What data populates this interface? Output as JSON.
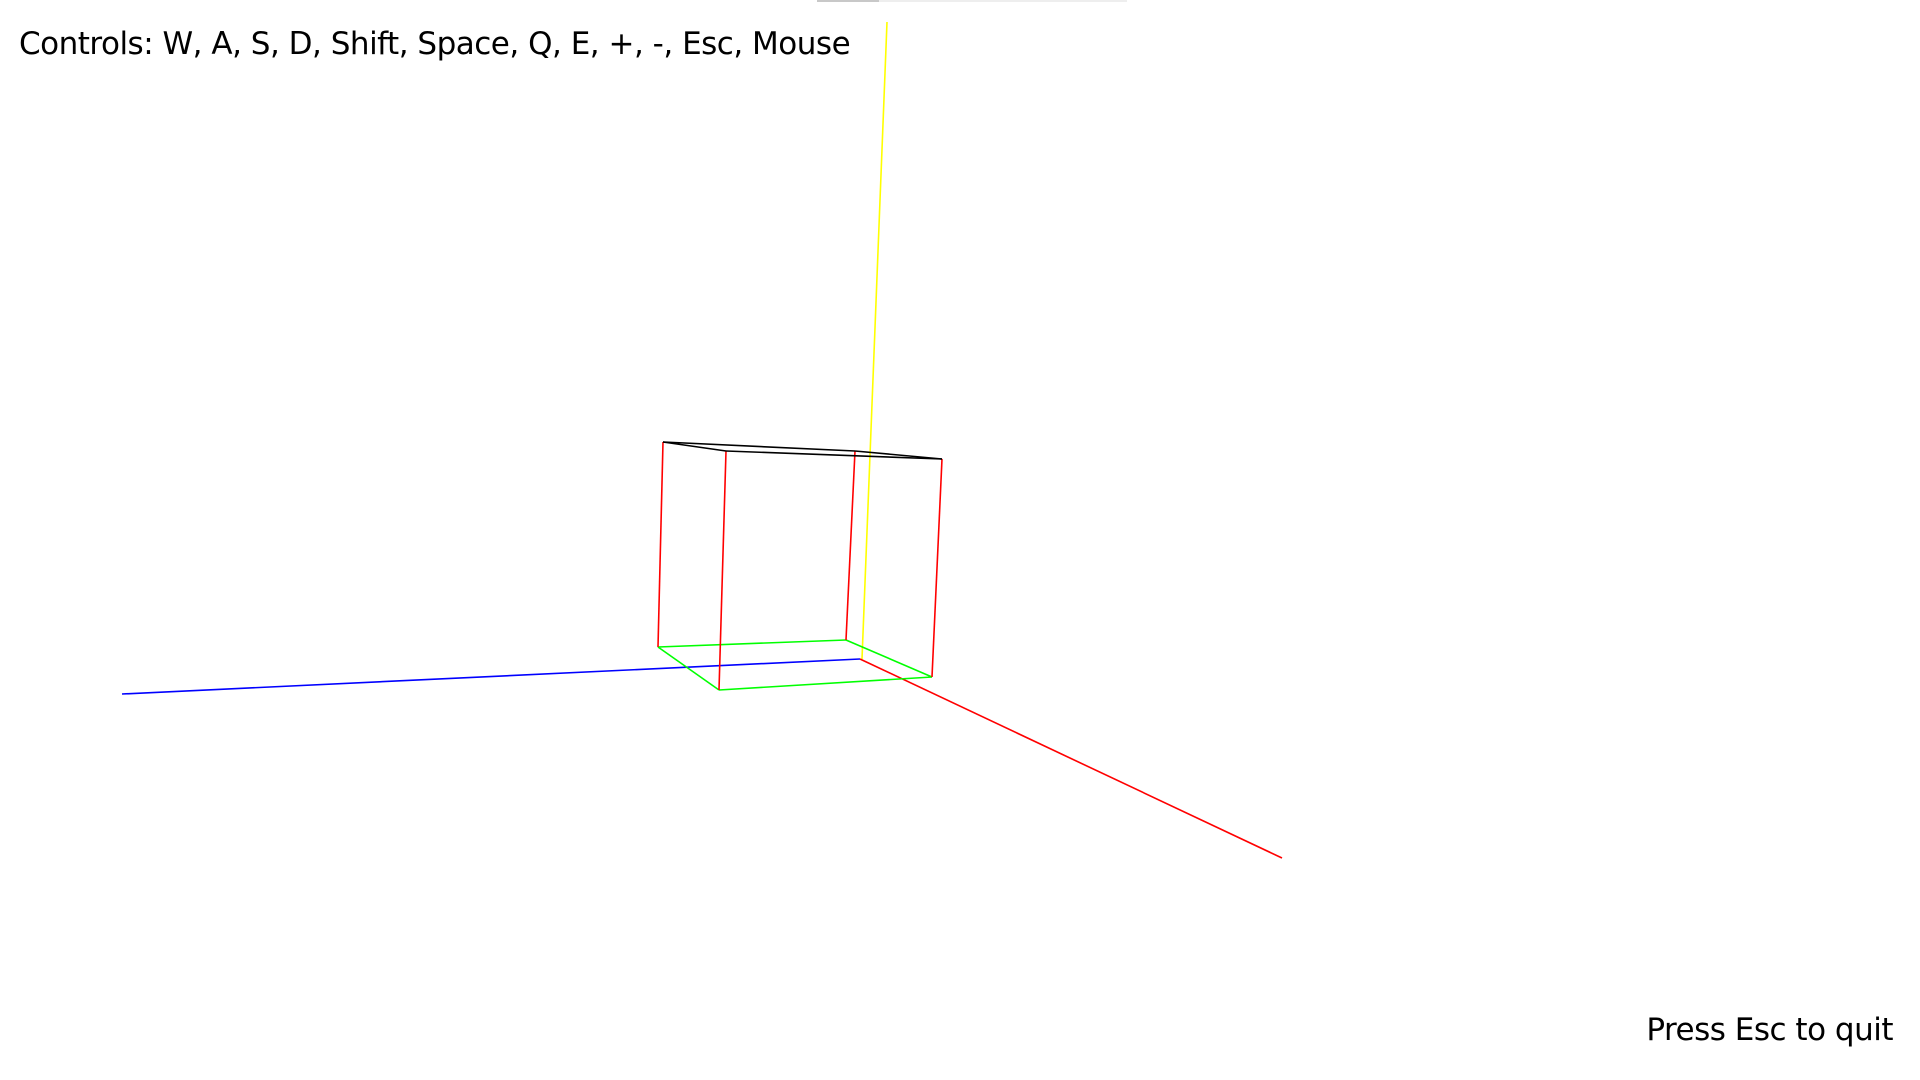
{
  "window": {
    "background": "#ffffff"
  },
  "hud": {
    "controls": "Controls: W, A, S, D, Shift, Space, Q, E, +, -, Esc, Mouse",
    "quit_hint": "Press Esc to quit"
  },
  "scene": {
    "axes": [
      {
        "name": "x-axis",
        "color": "#ff0000"
      },
      {
        "name": "y-axis",
        "color": "#ffff00"
      },
      {
        "name": "z-axis",
        "color": "#0000ff"
      }
    ],
    "cube": {
      "top_face_color": "#000000",
      "vertical_edges_color": "#ff0000",
      "bottom_face_color": "#00ff00"
    }
  }
}
